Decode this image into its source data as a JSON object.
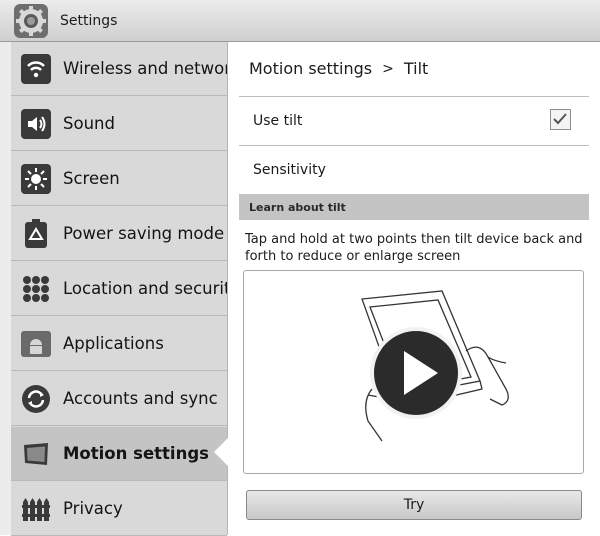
{
  "titlebar": {
    "title": "Settings",
    "icon": "settings-gear-icon"
  },
  "sidebar": {
    "items": [
      {
        "label": "Wireless and networks",
        "icon": "wifi-icon"
      },
      {
        "label": "Sound",
        "icon": "speaker-icon"
      },
      {
        "label": "Screen",
        "icon": "brightness-icon"
      },
      {
        "label": "Power saving mode",
        "icon": "recycle-icon"
      },
      {
        "label": "Location and security",
        "icon": "location-grid-icon"
      },
      {
        "label": "Applications",
        "icon": "android-icon"
      },
      {
        "label": "Accounts and sync",
        "icon": "sync-icon"
      },
      {
        "label": "Motion settings",
        "icon": "tablet-icon"
      },
      {
        "label": "Privacy",
        "icon": "fence-icon"
      }
    ],
    "active_index": 7
  },
  "content": {
    "breadcrumb": {
      "parent": "Motion settings",
      "separator": ">",
      "current": "Tilt"
    },
    "use_tilt": {
      "label": "Use tilt",
      "checked": true
    },
    "sensitivity": {
      "label": "Sensitivity"
    },
    "section": {
      "title": "Learn about tilt"
    },
    "description": "Tap and hold at two points then tilt device back and forth to reduce or enlarge screen",
    "video": {
      "icon": "play-icon"
    },
    "try_label": "Try"
  }
}
